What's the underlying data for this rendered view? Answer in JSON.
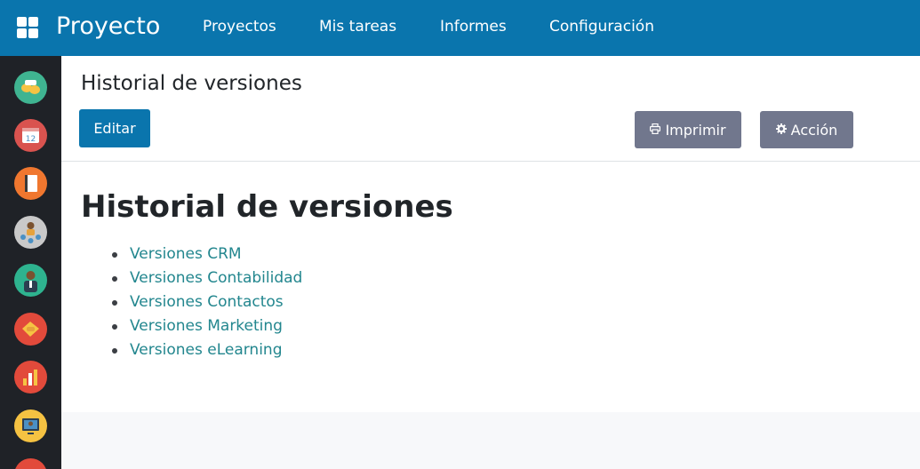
{
  "topbar": {
    "apps_icon": "grid-icon",
    "brand": "Proyecto",
    "nav": [
      "Proyectos",
      "Mis tareas",
      "Informes",
      "Configuración"
    ]
  },
  "sidebar": {
    "apps": [
      {
        "icon": "chat-app-icon",
        "color": "#3fb491"
      },
      {
        "icon": "calendar-app-icon",
        "color": "#d9534f",
        "label": "12"
      },
      {
        "icon": "notebook-app-icon",
        "color": "#f0772f"
      },
      {
        "icon": "team-app-icon",
        "color": "#c9c9c9"
      },
      {
        "icon": "employee-app-icon",
        "color": "#2eb38f"
      },
      {
        "icon": "handshake-app-icon",
        "color": "#e24a3b"
      },
      {
        "icon": "chart-app-icon",
        "color": "#e24a3b"
      },
      {
        "icon": "elearning-app-icon",
        "color": "#f5c242"
      },
      {
        "icon": "extra-app-icon",
        "color": "#e24a3b"
      }
    ]
  },
  "header": {
    "breadcrumb": "Historial de versiones",
    "edit_label": "Editar",
    "print_label": "Imprimir",
    "print_icon": "print-icon",
    "action_label": "Acción",
    "action_icon": "gear-icon"
  },
  "content": {
    "title": "Historial de versiones",
    "links": [
      "Versiones CRM",
      "Versiones Contabilidad",
      "Versiones Contactos",
      "Versiones Marketing",
      "Versiones eLearning"
    ]
  },
  "colors": {
    "primary": "#0a75ad",
    "secondary": "#71778d",
    "link": "#22868e",
    "sidebar_bg": "#1f2227"
  }
}
